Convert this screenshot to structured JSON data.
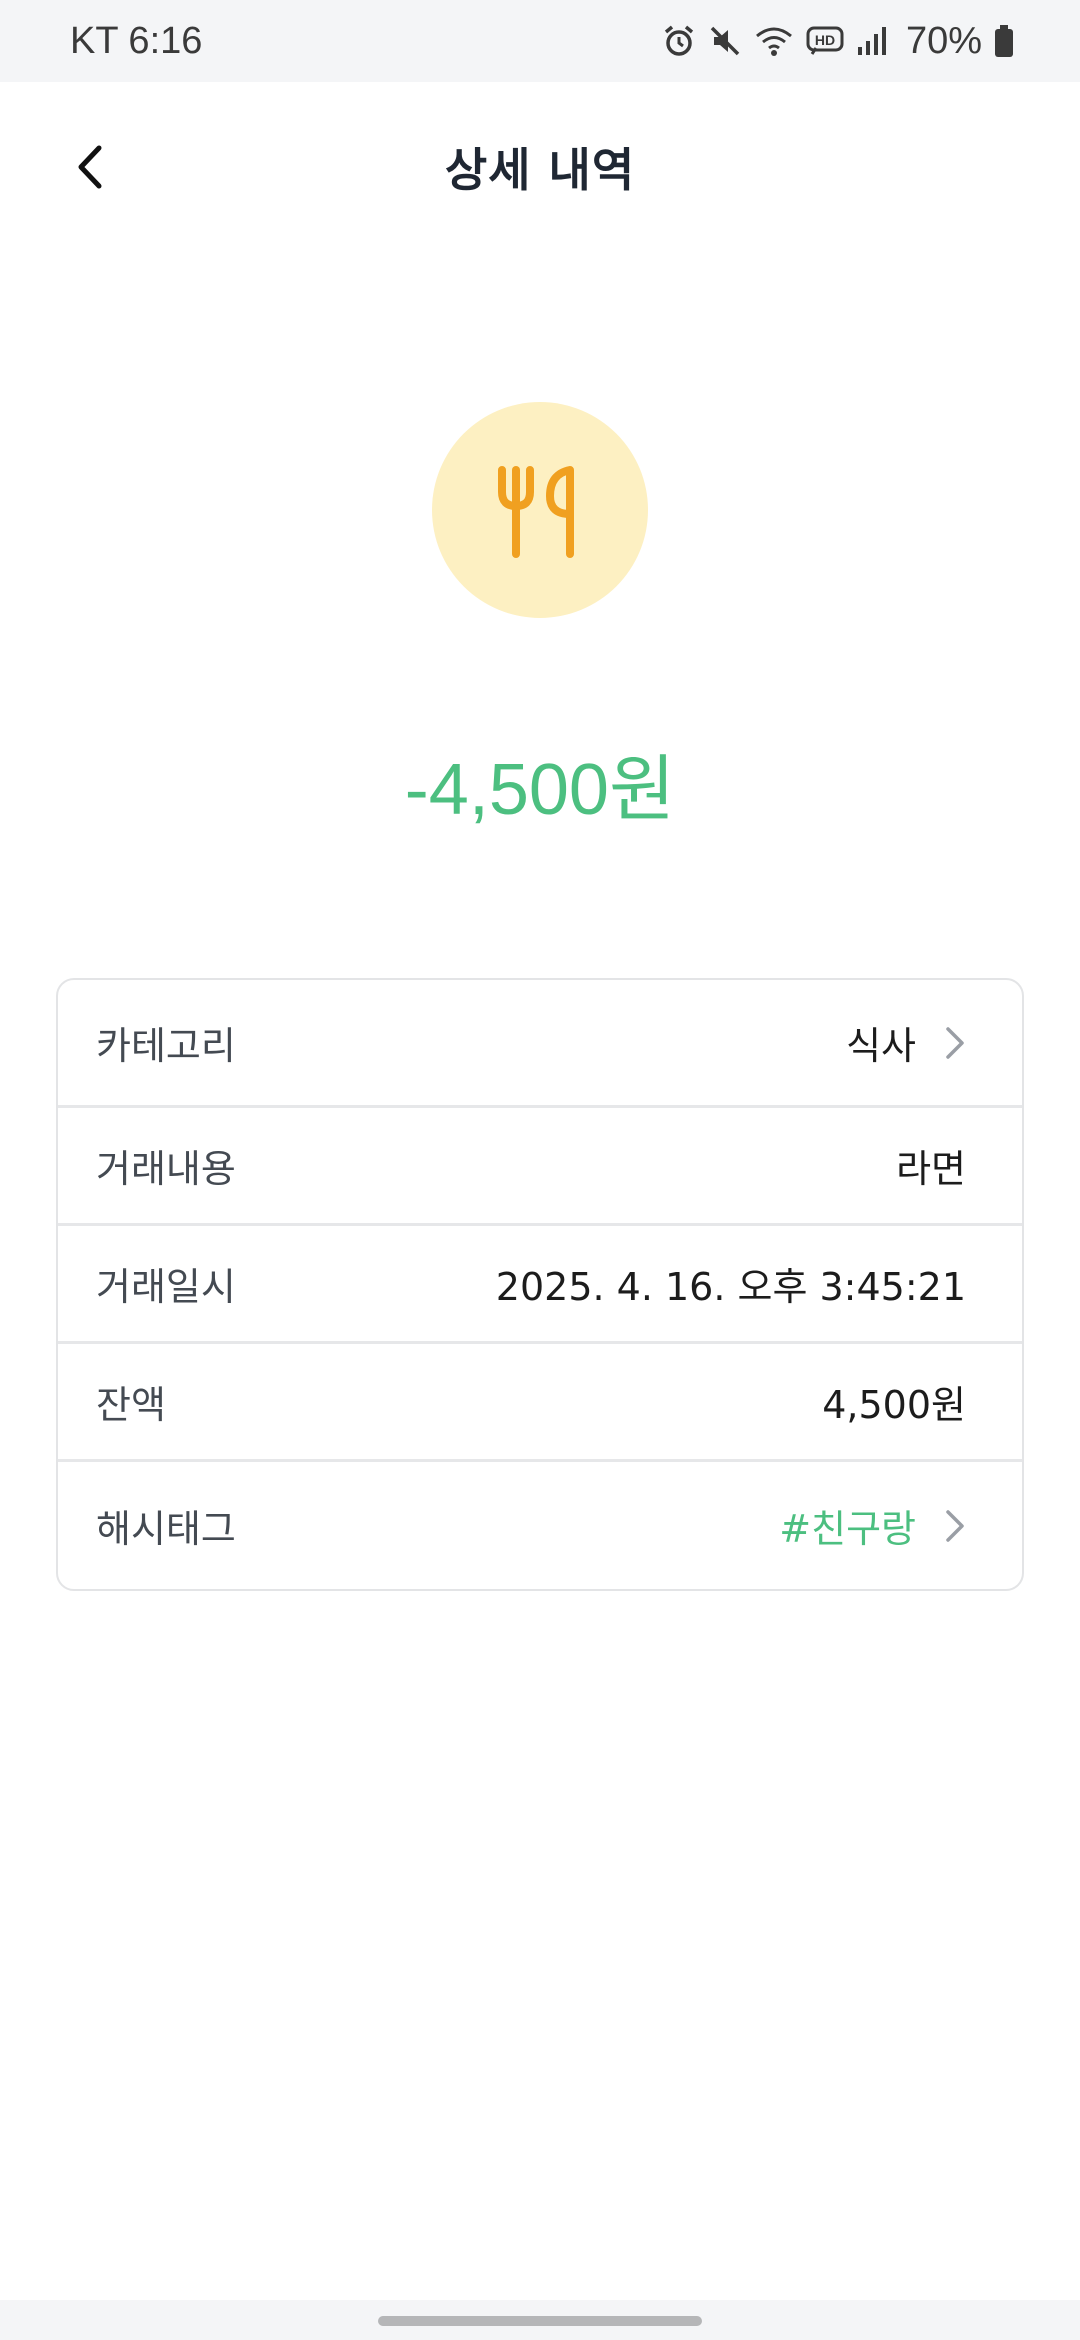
{
  "status_bar": {
    "carrier_time": "KT 6:16",
    "battery_percent": "70%",
    "icons": [
      "alarm-icon",
      "mute-icon",
      "wifi-icon",
      "hd-voice-icon",
      "signal-icon",
      "battery-icon"
    ]
  },
  "header": {
    "title": "상세 내역",
    "back_icon": "chevron-left-icon"
  },
  "transaction": {
    "category_icon": "fork-knife-icon",
    "amount": "-4,500원",
    "colors": {
      "amount": "#4cbf80",
      "icon": "#f0a020",
      "icon_bg": "#fdf0c2"
    }
  },
  "details": {
    "category": {
      "label": "카테고리",
      "value": "식사"
    },
    "description": {
      "label": "거래내용",
      "value": "라면"
    },
    "datetime": {
      "label": "거래일시",
      "value": "2025. 4. 16. 오후 3:45:21"
    },
    "balance": {
      "label": "잔액",
      "value": "4,500원"
    },
    "hashtag": {
      "label": "해시태그",
      "value": "#친구랑"
    }
  }
}
